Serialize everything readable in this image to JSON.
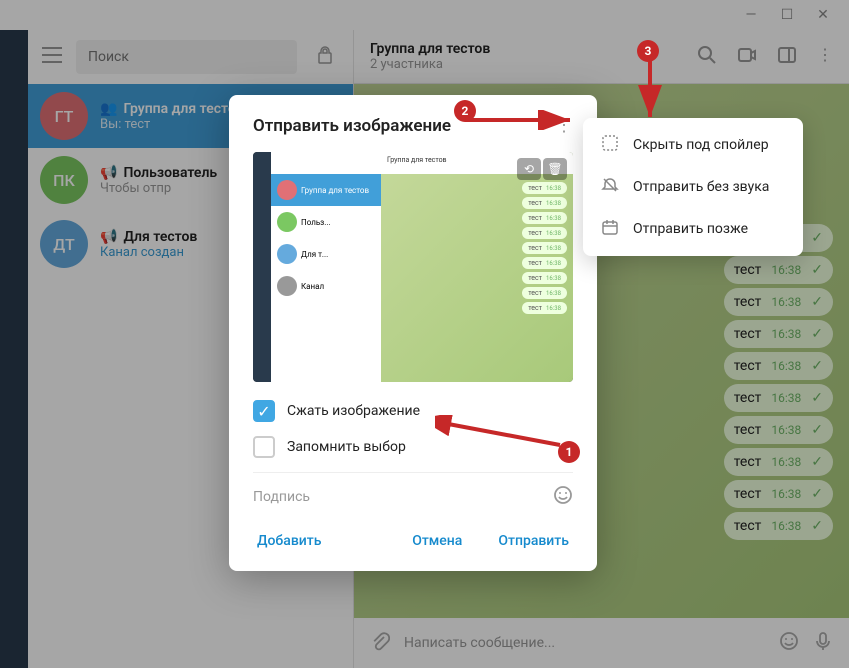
{
  "search": {
    "placeholder": "Поиск"
  },
  "chats": [
    {
      "avatar": "ГТ",
      "avatarBg": "#e17076",
      "title": "Группа для тестов",
      "sub_prefix": "Вы: ",
      "sub": "тест",
      "active": true
    },
    {
      "avatar": "ПК",
      "avatarBg": "#7bc862",
      "title": "Пользователь",
      "sub": "Чтобы отпр",
      "active": false
    },
    {
      "avatar": "ДТ",
      "avatarBg": "#65aadd",
      "title": "Для тестов",
      "sub": "Канал создан",
      "sub_link": true,
      "active": false
    }
  ],
  "header": {
    "title": "Группа для тестов",
    "members": "2 участника"
  },
  "messages": [
    {
      "text": "тест",
      "time": "16:38"
    },
    {
      "text": "тест",
      "time": "16:38"
    },
    {
      "text": "тест",
      "time": "16:38"
    },
    {
      "text": "тест",
      "time": "16:38"
    },
    {
      "text": "тест",
      "time": "16:38"
    },
    {
      "text": "тест",
      "time": "16:38"
    },
    {
      "text": "тест",
      "time": "16:38"
    },
    {
      "text": "тест",
      "time": "16:38"
    },
    {
      "text": "тест",
      "time": "16:38"
    },
    {
      "text": "тест",
      "time": "16:38"
    }
  ],
  "composer": {
    "placeholder": "Написать сообщение..."
  },
  "dialog": {
    "title": "Отправить изображение",
    "compress_label": "Сжать изображение",
    "remember_label": "Запомнить выбор",
    "caption_placeholder": "Подпись",
    "add": "Добавить",
    "cancel": "Отмена",
    "send": "Отправить"
  },
  "context_menu": [
    {
      "icon": "spoiler",
      "label": "Скрыть под спойлер"
    },
    {
      "icon": "mute",
      "label": "Отправить без звука"
    },
    {
      "icon": "schedule",
      "label": "Отправить позже"
    }
  ],
  "preview": {
    "header_title": "Группа для тестов",
    "msg_text": "тест",
    "msg_time": "16:38"
  },
  "annotations": {
    "b1": "1",
    "b2": "2",
    "b3": "3"
  }
}
